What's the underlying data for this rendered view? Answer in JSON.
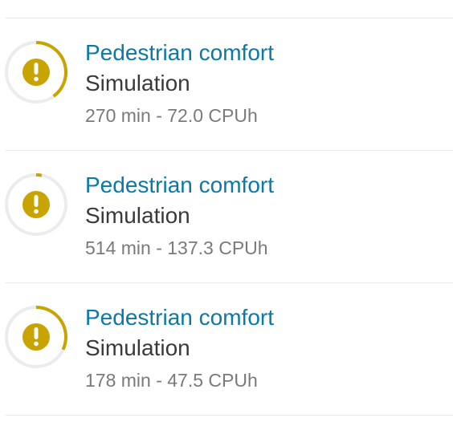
{
  "colors": {
    "title": "#0b79a7",
    "warning": "#c9a300",
    "track": "#ececec"
  },
  "jobs": [
    {
      "title": "Pedestrian comfort",
      "type": "Simulation",
      "meta": "270 min - 72.0 CPUh",
      "status_icon": "warning-icon",
      "progress": 0.4
    },
    {
      "title": "Pedestrian comfort",
      "type": "Simulation",
      "meta": "514 min - 137.3 CPUh",
      "status_icon": "warning-icon",
      "progress": 0.03
    },
    {
      "title": "Pedestrian comfort",
      "type": "Simulation",
      "meta": "178 min - 47.5 CPUh",
      "status_icon": "warning-icon",
      "progress": 0.32
    }
  ]
}
